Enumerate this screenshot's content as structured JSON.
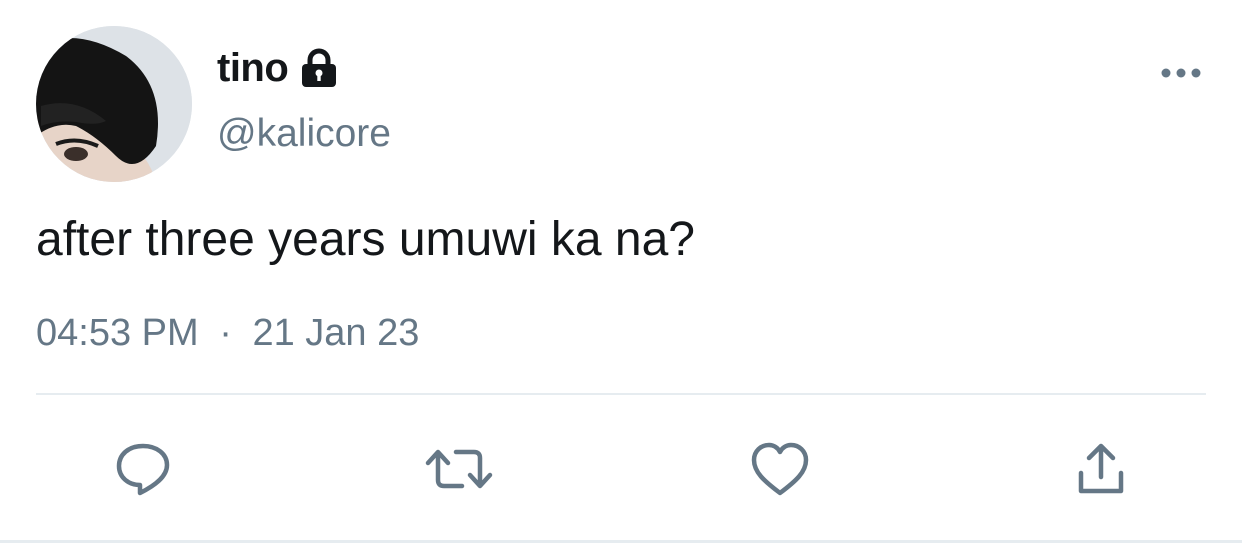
{
  "author": {
    "display_name": "tino",
    "handle": "@kalicore",
    "protected_icon": "lock-icon",
    "avatar_icon": "profile-photo"
  },
  "tweet": {
    "text": "after three years umuwi ka na?",
    "time": "04:53 PM",
    "separator": "·",
    "date": "21 Jan 23"
  },
  "actions": {
    "reply_icon": "reply-icon",
    "retweet_icon": "retweet-icon",
    "like_icon": "heart-icon",
    "share_icon": "share-icon",
    "more_icon": "more-icon"
  },
  "colors": {
    "text_primary": "#14171a",
    "text_secondary": "#657786",
    "icon": "#657786",
    "divider": "#e6ecf0"
  }
}
